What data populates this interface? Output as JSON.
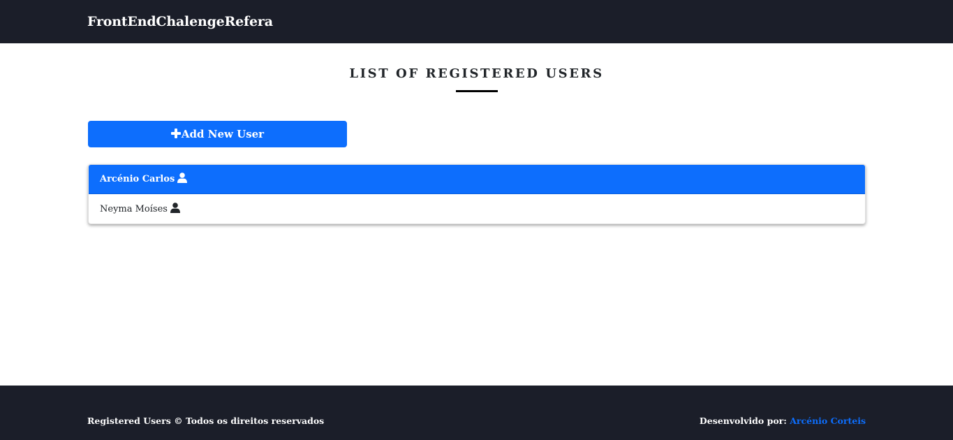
{
  "navbar": {
    "brand": "FrontEndChalengeRefera"
  },
  "main": {
    "title": "LIST OF REGISTERED USERS",
    "add_button": {
      "icon": "plus-icon",
      "label": "Add New User"
    },
    "users": [
      {
        "name": "Arcénio Carlos",
        "icon": "user-icon",
        "active": true
      },
      {
        "name": "Neyma Moíses",
        "icon": "user-icon",
        "active": false
      }
    ]
  },
  "footer": {
    "left_text": "Registered Users © Todos os direitos reservados",
    "developed_by_label": "Desenvolvido por:",
    "developer_link": "Arcénio Corteis"
  },
  "colors": {
    "navbar_bg": "#1b1e29",
    "accent": "#0d6efd",
    "text": "#212529"
  }
}
